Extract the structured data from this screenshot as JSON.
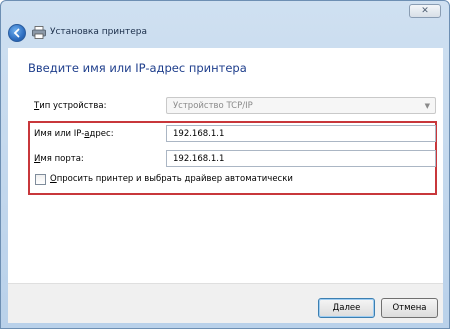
{
  "window": {
    "title": "Установка принтера",
    "close_glyph": "✕"
  },
  "page": {
    "heading": "Введите имя или IP-адрес принтера"
  },
  "form": {
    "device_type_label_first": "Т",
    "device_type_label_rest": "ип устройства:",
    "device_type_value": "Устройство TCP/IP",
    "host_label_before": "Имя или IP-",
    "host_label_underlined": "а",
    "host_label_after": "дрес:",
    "host_value": "192.168.1.1",
    "port_label_first": "И",
    "port_label_rest": "мя порта:",
    "port_value": "192.168.1.1",
    "auto_driver_first": "О",
    "auto_driver_rest": "просить принтер и выбрать драйвер автоматически",
    "auto_driver_checked": false
  },
  "buttons": {
    "next": "Далее",
    "cancel": "Отмена"
  },
  "colors": {
    "heading": "#1e3e8c",
    "highlight_border": "#c8373b"
  },
  "icons": {
    "back": "back-arrow-icon",
    "printer": "printer-icon",
    "dropdown": "chevron-down-icon"
  }
}
